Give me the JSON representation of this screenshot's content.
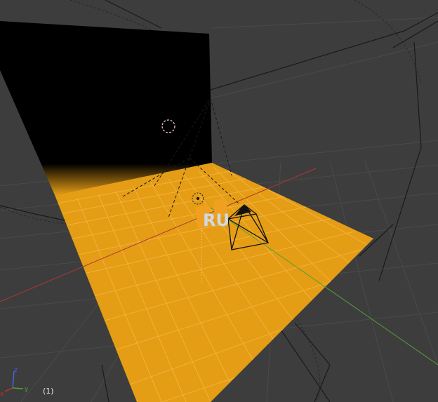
{
  "viewport": {
    "frame_label": "(1)",
    "text_object_label": "RU",
    "colors": {
      "background": "#3d3d3d",
      "grid_line": "#4a4a4a",
      "backdrop": "#000000",
      "floor_plane": "#e49d15",
      "floor_grid": "#f3b23a",
      "x_axis": "#b03535",
      "y_axis": "#55a036",
      "z_axis": "#3f63d6",
      "text_object": "#f0a020",
      "text_object_selected": "#d8d8d8"
    },
    "axis_widget": {
      "x_label": "x",
      "y_label": "y",
      "z_label": "z"
    }
  }
}
